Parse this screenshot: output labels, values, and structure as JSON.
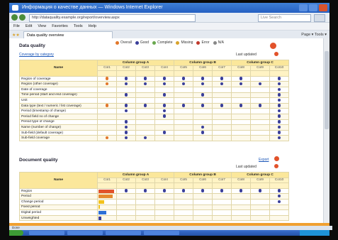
{
  "browser": {
    "title": "Информация о качестве данных — Windows Internet Explorer",
    "address": "http://dataquality.example.org/report/overview.aspx",
    "search_placeholder": "Live Search",
    "menu": [
      "File",
      "Edit",
      "View",
      "Favorites",
      "Tools",
      "Help"
    ],
    "tab_label": "Data quality overview",
    "tab_tools": "Page ▾  Tools ▾"
  },
  "section1": {
    "title": "Data quality",
    "legend": [
      {
        "label": "Overall",
        "color": "#e2772a"
      },
      {
        "label": "Good",
        "color": "#3a3f9a"
      },
      {
        "label": "Complete",
        "color": "#6aa84f"
      },
      {
        "label": "Missing",
        "color": "#d9a32c"
      },
      {
        "label": "Error",
        "color": "#c0392b"
      },
      {
        "label": "N/A",
        "color": "#888888"
      }
    ],
    "left_link": "Coverage by category",
    "right_note": "Last updated",
    "table": {
      "name_header": "Name",
      "group_headers": [
        "Column group A",
        "Column group B",
        "Column group C"
      ],
      "columns": [
        "Col1",
        "Col2",
        "Col3",
        "Col4",
        "Col5",
        "Col6",
        "Col7",
        "Col8",
        "Col9",
        "Col10"
      ],
      "rows": [
        {
          "name": "Region of coverage",
          "cells": [
            "o",
            "d",
            "d",
            "d",
            "d",
            "d",
            "d",
            "d",
            "",
            "d"
          ]
        },
        {
          "name": "Region (other coverage)",
          "cells": [
            "o",
            "d",
            "d",
            "d",
            "d",
            "d",
            "d",
            "d",
            "d",
            "d"
          ]
        },
        {
          "name": "Date of coverage",
          "cells": [
            "",
            "",
            "",
            "",
            "",
            "",
            "",
            "",
            "",
            "d"
          ]
        },
        {
          "name": "Time period (start and end coverage)",
          "cells": [
            "",
            "d",
            "",
            "d",
            "",
            "d",
            "",
            "",
            "",
            "d"
          ]
        },
        {
          "name": "Unit",
          "cells": [
            "",
            "",
            "",
            "",
            "",
            "",
            "",
            "",
            "",
            "d"
          ]
        },
        {
          "name": "Data type (text / numeric / list coverage)",
          "cells": [
            "o",
            "d",
            "d",
            "d",
            "d",
            "d",
            "d",
            "d",
            "d",
            "d"
          ]
        },
        {
          "name": "Period (timestamp of change)",
          "cells": [
            "",
            "d",
            "",
            "d",
            "",
            "",
            "",
            "",
            "",
            "d"
          ]
        },
        {
          "name": "Period field no of change",
          "cells": [
            "",
            "",
            "",
            "d",
            "",
            "",
            "",
            "",
            "",
            "d"
          ]
        },
        {
          "name": "Period type of change",
          "cells": [
            "",
            "d",
            "",
            "",
            "",
            "",
            "",
            "",
            "",
            "d"
          ]
        },
        {
          "name": "Name (number of change)",
          "cells": [
            "",
            "d",
            "",
            "",
            "",
            "d",
            "",
            "",
            "",
            "d"
          ]
        },
        {
          "name": "Sub-field (default coverage)",
          "cells": [
            "",
            "d",
            "",
            "d",
            "",
            "d",
            "",
            "",
            "",
            "d"
          ]
        },
        {
          "name": "Sub-field coverage",
          "cells": [
            "o",
            "d",
            "d",
            "",
            "",
            "",
            "",
            "",
            "",
            "d"
          ]
        }
      ]
    }
  },
  "section2": {
    "title": "Document quality",
    "right_note": "Last updated",
    "top_link": "Export",
    "table": {
      "name_header": "Name",
      "group_headers": [
        "Column group A",
        "Column group B",
        "Column group C"
      ],
      "columns": [
        "Col1",
        "Col2",
        "Col3",
        "Col4",
        "Col5",
        "Col6",
        "Col7",
        "Col8",
        "Col9",
        "Col10"
      ],
      "rows": [
        {
          "name": "Region",
          "bar": {
            "color": "#e2522a",
            "fill": 0.9
          },
          "cells": [
            "",
            "d",
            "d",
            "d",
            "d",
            "d",
            "d",
            "d",
            "d",
            "d"
          ]
        },
        {
          "name": "Period",
          "bar": {
            "color": "#e58a2e",
            "fill": 0.85
          },
          "cells": [
            "",
            "",
            "",
            "",
            "",
            "",
            "",
            "",
            "",
            "d"
          ]
        },
        {
          "name": "Change period",
          "bar": {
            "color": "#f2c21b",
            "fill": 0.35
          },
          "cells": [
            "",
            "",
            "",
            "",
            "",
            "",
            "",
            "",
            "",
            "d"
          ]
        },
        {
          "name": "Fixed period",
          "bar": {
            "color": "#f2c21b",
            "fill": 0.1
          },
          "cells": [
            "",
            "",
            "",
            "",
            "",
            "",
            "",
            "",
            "",
            ""
          ]
        },
        {
          "name": "Digital period",
          "bar": {
            "color": "#2c6fd6",
            "fill": 0.45
          },
          "cells": [
            "",
            "",
            "",
            "",
            "",
            "",
            "",
            "",
            "",
            ""
          ]
        },
        {
          "name": "Unweighted",
          "bar": {
            "color": "#3a3f9a",
            "fill": 0.15
          },
          "cells": [
            "",
            "",
            "",
            "",
            "",
            "",
            "",
            "",
            "",
            ""
          ]
        }
      ]
    }
  },
  "status": {
    "text": "Done"
  }
}
